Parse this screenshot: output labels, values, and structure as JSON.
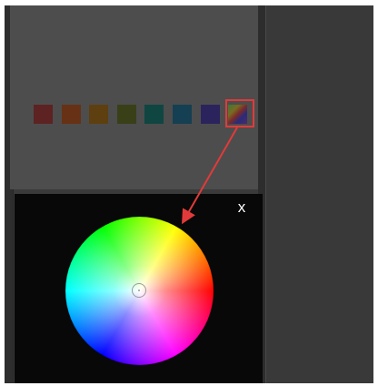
{
  "swatches": [
    {
      "name": "swatch-red",
      "color": "#5d2222"
    },
    {
      "name": "swatch-orange",
      "color": "#663114"
    },
    {
      "name": "swatch-amber",
      "color": "#5e3f10"
    },
    {
      "name": "swatch-olive",
      "color": "#394018"
    },
    {
      "name": "swatch-teal",
      "color": "#0f4642"
    },
    {
      "name": "swatch-steel-blue",
      "color": "#153f52"
    },
    {
      "name": "swatch-indigo",
      "color": "#2b235c"
    },
    {
      "name": "swatch-multicolor",
      "color": "multicolor"
    }
  ],
  "close_label": "x",
  "colors": {
    "highlight": "#e23a3a",
    "arrow": "#e23a3a",
    "panel_dark": "#080808",
    "panel_gray": "#4d4d4d"
  }
}
